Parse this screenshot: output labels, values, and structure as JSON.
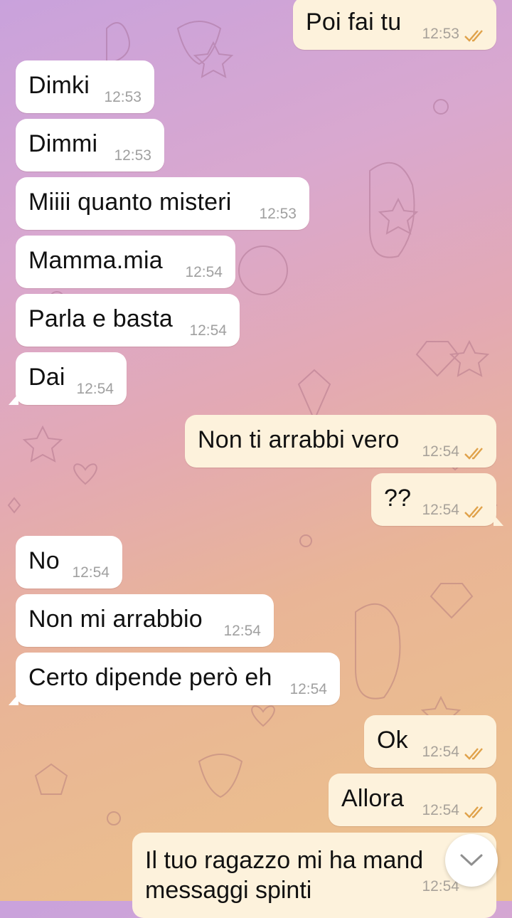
{
  "theme": {
    "incoming_bg": "#ffffff",
    "outgoing_bg": "#fdf2dc",
    "tick_color": "#e0a24a"
  },
  "messages": [
    {
      "dir": "out",
      "text": "Poi fai tu",
      "time": "12:53",
      "read": true
    },
    {
      "dir": "in",
      "text": "Dimki",
      "time": "12:53"
    },
    {
      "dir": "in",
      "text": "Dimmi",
      "time": "12:53"
    },
    {
      "dir": "in",
      "text": "Miiii quanto misteri",
      "time": "12:53"
    },
    {
      "dir": "in",
      "text": "Mamma.mia",
      "time": "12:54"
    },
    {
      "dir": "in",
      "text": "Parla e basta",
      "time": "12:54"
    },
    {
      "dir": "in",
      "text": "Dai",
      "time": "12:54"
    },
    {
      "dir": "out",
      "text": "Non ti arrabbi vero",
      "time": "12:54",
      "read": true
    },
    {
      "dir": "out",
      "text": "??",
      "time": "12:54",
      "read": true
    },
    {
      "dir": "in",
      "text": "No",
      "time": "12:54"
    },
    {
      "dir": "in",
      "text": "Non mi arrabbio",
      "time": "12:54"
    },
    {
      "dir": "in",
      "text": "Certo dipende però eh",
      "time": "12:54"
    },
    {
      "dir": "out",
      "text": "Ok",
      "time": "12:54",
      "read": true
    },
    {
      "dir": "out",
      "text": "Allora",
      "time": "12:54",
      "read": true
    }
  ],
  "last_message": {
    "line1": "Il tuo ragazzo mi ha mand",
    "line2": "messaggi spinti",
    "time": "12:54"
  },
  "scroll_button": {
    "icon": "chevron-down-icon"
  }
}
